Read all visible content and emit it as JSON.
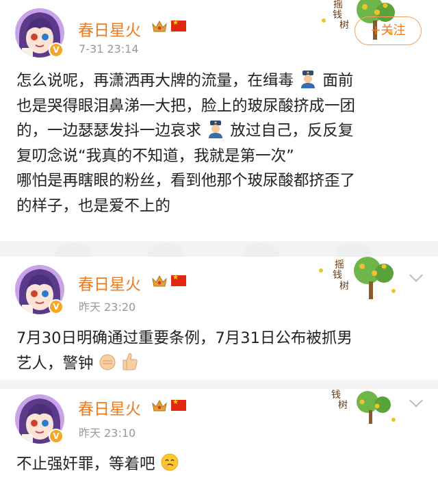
{
  "posts": [
    {
      "username": "春日星火",
      "timestamp": "7-31 23:14",
      "follow_label": "+关注",
      "tree_text": [
        "摇",
        "钱",
        "树"
      ],
      "content_lines": [
        [
          "怎么说呢，再潇洒再大牌的流量，在缉毒",
          "面前"
        ],
        [
          "也是哭得眼泪鼻涕一大把，脸上的玻尿酸挤成一团"
        ],
        [
          "的，一边瑟瑟发抖一边哀求",
          "放过自己，反反复"
        ],
        [
          "复叨念说“我真的不知道，我就是第一次”"
        ],
        [
          "哪怕是再瞎眼的粉丝，看到他那个玻尿酸都挤歪了"
        ],
        [
          "的样子，也是爱不上的"
        ]
      ]
    },
    {
      "username": "春日星火",
      "timestamp": "昨天 23:20",
      "tree_text": [
        "摇",
        "钱",
        "树"
      ],
      "content_lines": [
        [
          "7月30日明确通过重要条例，7月31日公布被抓男"
        ],
        [
          "艺人，警钟"
        ]
      ]
    },
    {
      "username": "春日星火",
      "timestamp": "昨天 23:10",
      "tree_text": [
        "钱",
        "树"
      ],
      "content_lines": [
        [
          "不止强奸罪，等着吧"
        ]
      ]
    }
  ],
  "icons": {
    "verified": "v-badge-icon",
    "crown": "crown-icon",
    "flag": "china-flag-icon",
    "police": "police-officer-emoji",
    "fist": "fist-emoji",
    "thumbs_up": "thumbs-up-emoji",
    "tears": "holding-back-tears-emoji",
    "expand": "chevron-down-icon"
  },
  "colors": {
    "username": "#f07a1a",
    "follow_border": "#f5a15a",
    "meta": "#999999",
    "verified": "#f5a623"
  }
}
